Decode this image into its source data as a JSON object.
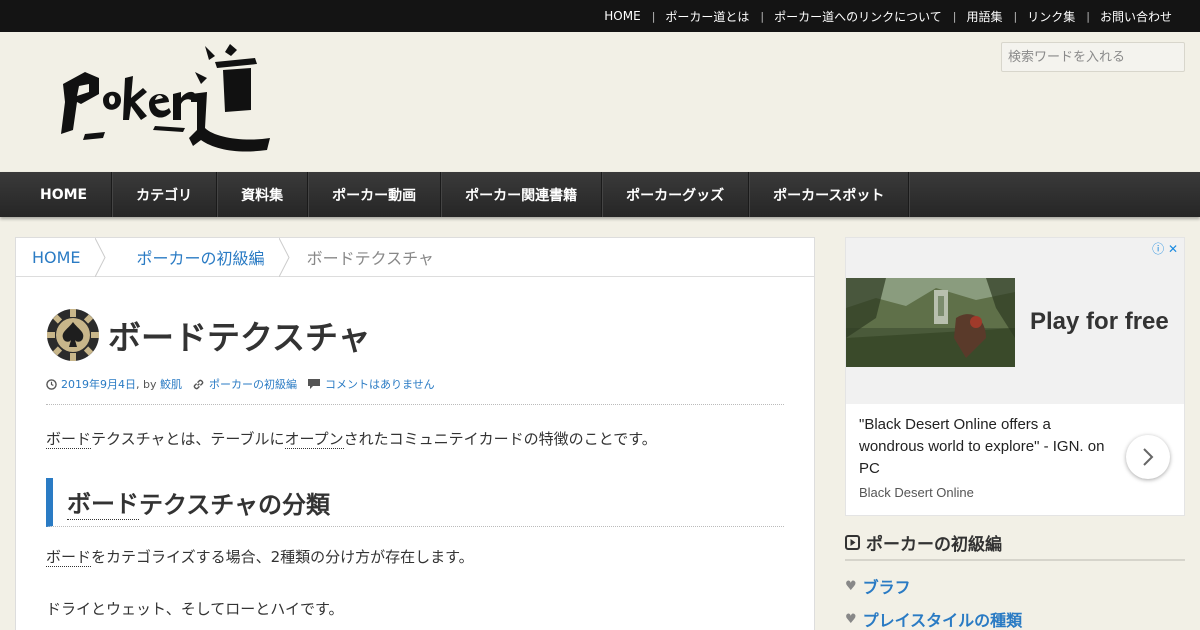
{
  "topnav": {
    "items": [
      "HOME",
      "ポーカー道とは",
      "ポーカー道へのリンクについて",
      "用語集",
      "リンク集",
      "お問い合わせ"
    ]
  },
  "header": {
    "logo_text": "Poker道",
    "search_placeholder": "検索ワードを入れる"
  },
  "globalnav": {
    "items": [
      "HOME",
      "カテゴリ",
      "資料集",
      "ポーカー動画",
      "ポーカー関連書籍",
      "ポーカーグッズ",
      "ポーカースポット"
    ]
  },
  "breadcrumb": {
    "home": "HOME",
    "category": "ポーカーの初級編",
    "current": "ボードテクスチャ"
  },
  "article": {
    "title": "ボードテクスチャ",
    "date": "2019年9月4日",
    "by": ", by",
    "author": "鮫肌",
    "category": "ポーカーの初級編",
    "comments": "コメントはありません",
    "p1": {
      "term1": "ボード",
      "text1": "テクスチャとは、テーブルに",
      "term2": "オープン",
      "text2": "されたコミュニテイカードの特徴のことです。"
    },
    "h2": {
      "term": "ボード",
      "text": "テクスチャの分類"
    },
    "p2": {
      "term": "ボード",
      "text": "をカテゴライズする場合、2種類の分け方が存在します。"
    },
    "p3": "ドライとウェット、そしてローとハイです。"
  },
  "ad": {
    "cta": "Play for free",
    "quote": "\"Black Desert Online offers a wondrous world to explore\" - IGN. on PC",
    "source": "Black Desert Online",
    "info_icon": "ⓘ",
    "close_icon": "✕"
  },
  "sidebar": {
    "heading": "ポーカーの初級編",
    "items": [
      "ブラフ",
      "プレイスタイルの種類"
    ]
  },
  "colors": {
    "link": "#2a7bc4",
    "nav_bg": "#2e2e2e",
    "page_bg": "#f2f0e6"
  }
}
